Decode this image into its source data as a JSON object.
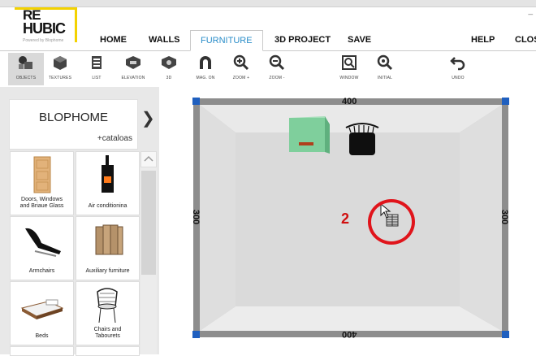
{
  "app": {
    "logo_line1": "RE",
    "logo_line2": "HUBIC",
    "logo_tagline": "Powered by Blophome",
    "window_minimize": "_"
  },
  "menu": {
    "home": "HOME",
    "walls": "WALLS",
    "furniture": "FURNITURE",
    "project3d": "3D PROJECT",
    "save": "SAVE",
    "help": "HELP",
    "close": "CLOS"
  },
  "toolbar": {
    "objects": "OBJECTS",
    "textures": "TEXTURES",
    "list": "LIST",
    "elevation": "ELEVATION",
    "view3d": "3D",
    "magnet": "MAG. ON",
    "zoom_in": "ZOOM +",
    "zoom_out": "ZOOM -",
    "window": "WINDOW",
    "initial": "INITIAL",
    "undo": "UNDO"
  },
  "sidebar": {
    "catalog_title": "BLOPHOME",
    "catalog_sub": "+cataloas",
    "categories": [
      {
        "label_line1": "Doors, Windows",
        "label_line2": "and Briaue Glass"
      },
      {
        "label_line1": "Air conditionina",
        "label_line2": ""
      },
      {
        "label_line1": "Armchairs",
        "label_line2": ""
      },
      {
        "label_line1": "Auxiliary furniture",
        "label_line2": ""
      },
      {
        "label_line1": "Beds",
        "label_line2": ""
      },
      {
        "label_line1": "Chairs and",
        "label_line2": "Tabourets"
      }
    ]
  },
  "canvas": {
    "dim_top": "400",
    "dim_bottom": "400",
    "dim_left": "300",
    "dim_right": "300",
    "annotation_number": "2"
  },
  "colors": {
    "accent_blue": "#2a8dc9",
    "logo_yellow": "#f3d200",
    "annotation_red": "#e0141b",
    "corner_blue": "#1f5fbf",
    "wall_grey": "#8a8a8a",
    "floor_grey": "#dcdcdc"
  }
}
